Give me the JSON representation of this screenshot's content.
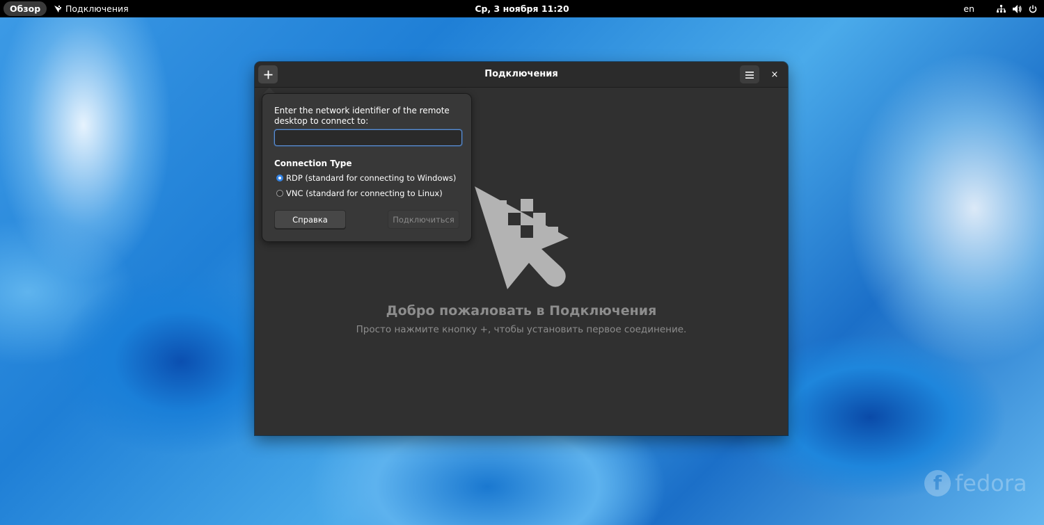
{
  "topbar": {
    "activities_label": "Обзор",
    "app_name": "Подключения",
    "clock": "Ср, 3 ноября  11:20",
    "language": "en",
    "tray_icons": [
      "network-icon",
      "volume-icon",
      "power-icon"
    ]
  },
  "window": {
    "title": "Подключения",
    "add_icon": "plus-icon",
    "menu_icon": "hamburger-menu-icon",
    "close_glyph": "×",
    "welcome_title": "Добро пожаловать в Подключения",
    "welcome_subtitle": "Просто нажмите кнопку +, чтобы установить первое соединение."
  },
  "popover": {
    "prompt": "Enter the network identifier of the remote desktop to connect to:",
    "address_value": "",
    "connection_type_label": "Connection Type",
    "options": [
      {
        "label": "RDP (standard for connecting to Windows)",
        "checked": true
      },
      {
        "label": "VNC (standard for connecting to Linux)",
        "checked": false
      }
    ],
    "help_label": "Справка",
    "connect_label": "Подключиться"
  },
  "branding": {
    "wordmark": "fedora"
  },
  "colors": {
    "accent": "#3584e4",
    "window_bg": "#303030",
    "headerbar_bg": "#2b2b2b",
    "popover_bg": "#383838"
  }
}
